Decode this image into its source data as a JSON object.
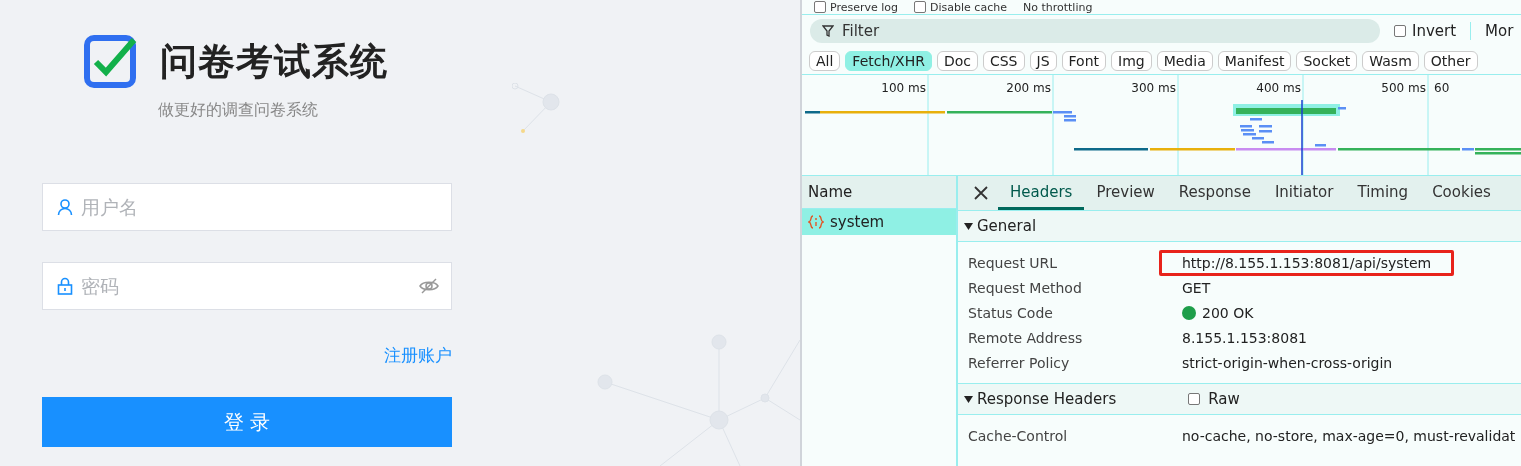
{
  "login": {
    "title": "问卷考试系统",
    "subtitle": "做更好的调查问卷系统",
    "fields": [
      {
        "kind": "user",
        "placeholder": "用户名"
      },
      {
        "kind": "password",
        "placeholder": "密码"
      }
    ],
    "register_link": "注册账户",
    "submit": "登 录"
  },
  "devtools": {
    "toolbar": [
      {
        "label": "Preserve log",
        "checked": false
      },
      {
        "label": "Disable cache",
        "checked": false
      }
    ],
    "throttling": "No throttling",
    "filter": {
      "placeholder": "Filter",
      "invert": {
        "label": "Invert",
        "checked": false
      },
      "more": "Mor"
    },
    "type_filters": [
      {
        "label": "All",
        "selected": false
      },
      {
        "label": "Fetch/XHR",
        "selected": true
      },
      {
        "label": "Doc",
        "selected": false
      },
      {
        "label": "CSS",
        "selected": false
      },
      {
        "label": "JS",
        "selected": false
      },
      {
        "label": "Font",
        "selected": false
      },
      {
        "label": "Img",
        "selected": false
      },
      {
        "label": "Media",
        "selected": false
      },
      {
        "label": "Manifest",
        "selected": false
      },
      {
        "label": "Socket",
        "selected": false
      },
      {
        "label": "Wasm",
        "selected": false
      },
      {
        "label": "Other",
        "selected": false
      }
    ],
    "timeline_ticks": [
      "100 ms",
      "200 ms",
      "300 ms",
      "400 ms",
      "500 ms",
      "60"
    ],
    "requests": {
      "column": "Name",
      "rows": [
        {
          "name": "system",
          "selected": true
        }
      ]
    },
    "detail_tabs": [
      {
        "label": "Headers",
        "selected": true
      },
      {
        "label": "Preview",
        "selected": false
      },
      {
        "label": "Response",
        "selected": false
      },
      {
        "label": "Initiator",
        "selected": false
      },
      {
        "label": "Timing",
        "selected": false
      },
      {
        "label": "Cookies",
        "selected": false
      }
    ],
    "general": {
      "title": "General",
      "expanded": true,
      "rows": [
        {
          "kind": "text",
          "key": "Request URL",
          "value": "http://8.155.1.153:8081/api/system",
          "highlighted": true
        },
        {
          "kind": "text",
          "key": "Request Method",
          "value": "GET",
          "highlighted": false
        },
        {
          "kind": "status",
          "key": "Status Code",
          "value": "200 OK",
          "highlighted": false
        },
        {
          "kind": "text",
          "key": "Remote Address",
          "value": "8.155.1.153:8081",
          "highlighted": false
        },
        {
          "kind": "text",
          "key": "Referrer Policy",
          "value": "strict-origin-when-cross-origin",
          "highlighted": false
        }
      ]
    },
    "response_headers": {
      "title": "Response Headers",
      "expanded": true,
      "raw": {
        "label": "Raw",
        "checked": false
      },
      "rows": [
        {
          "kind": "text",
          "key": "Cache-Control",
          "value": "no-cache, no-store, max-age=0, must-revalidat",
          "highlighted": false
        }
      ]
    }
  }
}
